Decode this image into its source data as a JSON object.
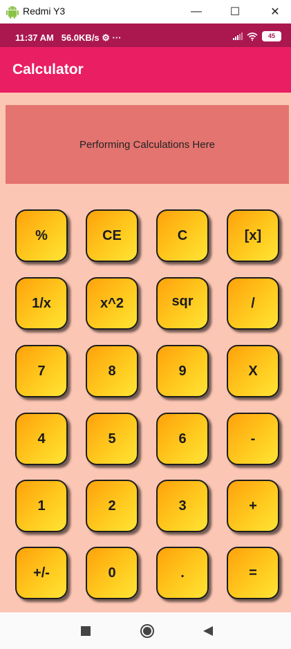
{
  "window": {
    "title": "Redmi Y3",
    "minimize_glyph": "—",
    "maximize_glyph": "☐",
    "close_glyph": "✕"
  },
  "status": {
    "time": "11:37 AM",
    "speed": "56.0KB/s",
    "extra": "⚙ ···",
    "battery": "45"
  },
  "app": {
    "title": "Calculator",
    "display_text": "Performing Calculations Here"
  },
  "keys": [
    "%",
    "CE",
    "C",
    "[x]",
    "1/x",
    "x^2",
    "sqr",
    "/",
    "7",
    "8",
    "9",
    "X",
    "4",
    "5",
    "6",
    "-",
    "1",
    "2",
    "3",
    "+",
    "+/-",
    "0",
    ".",
    "="
  ],
  "colors": {
    "status_bar": "#ab1850",
    "app_bar": "#e91e63",
    "background": "#fcc6b4",
    "display": "#e47470",
    "key_start": "#ffa20c",
    "key_end": "#ffe436"
  },
  "icons": {
    "nav_recent": "square-icon",
    "nav_home": "circle-icon",
    "nav_back": "triangle-icon"
  }
}
